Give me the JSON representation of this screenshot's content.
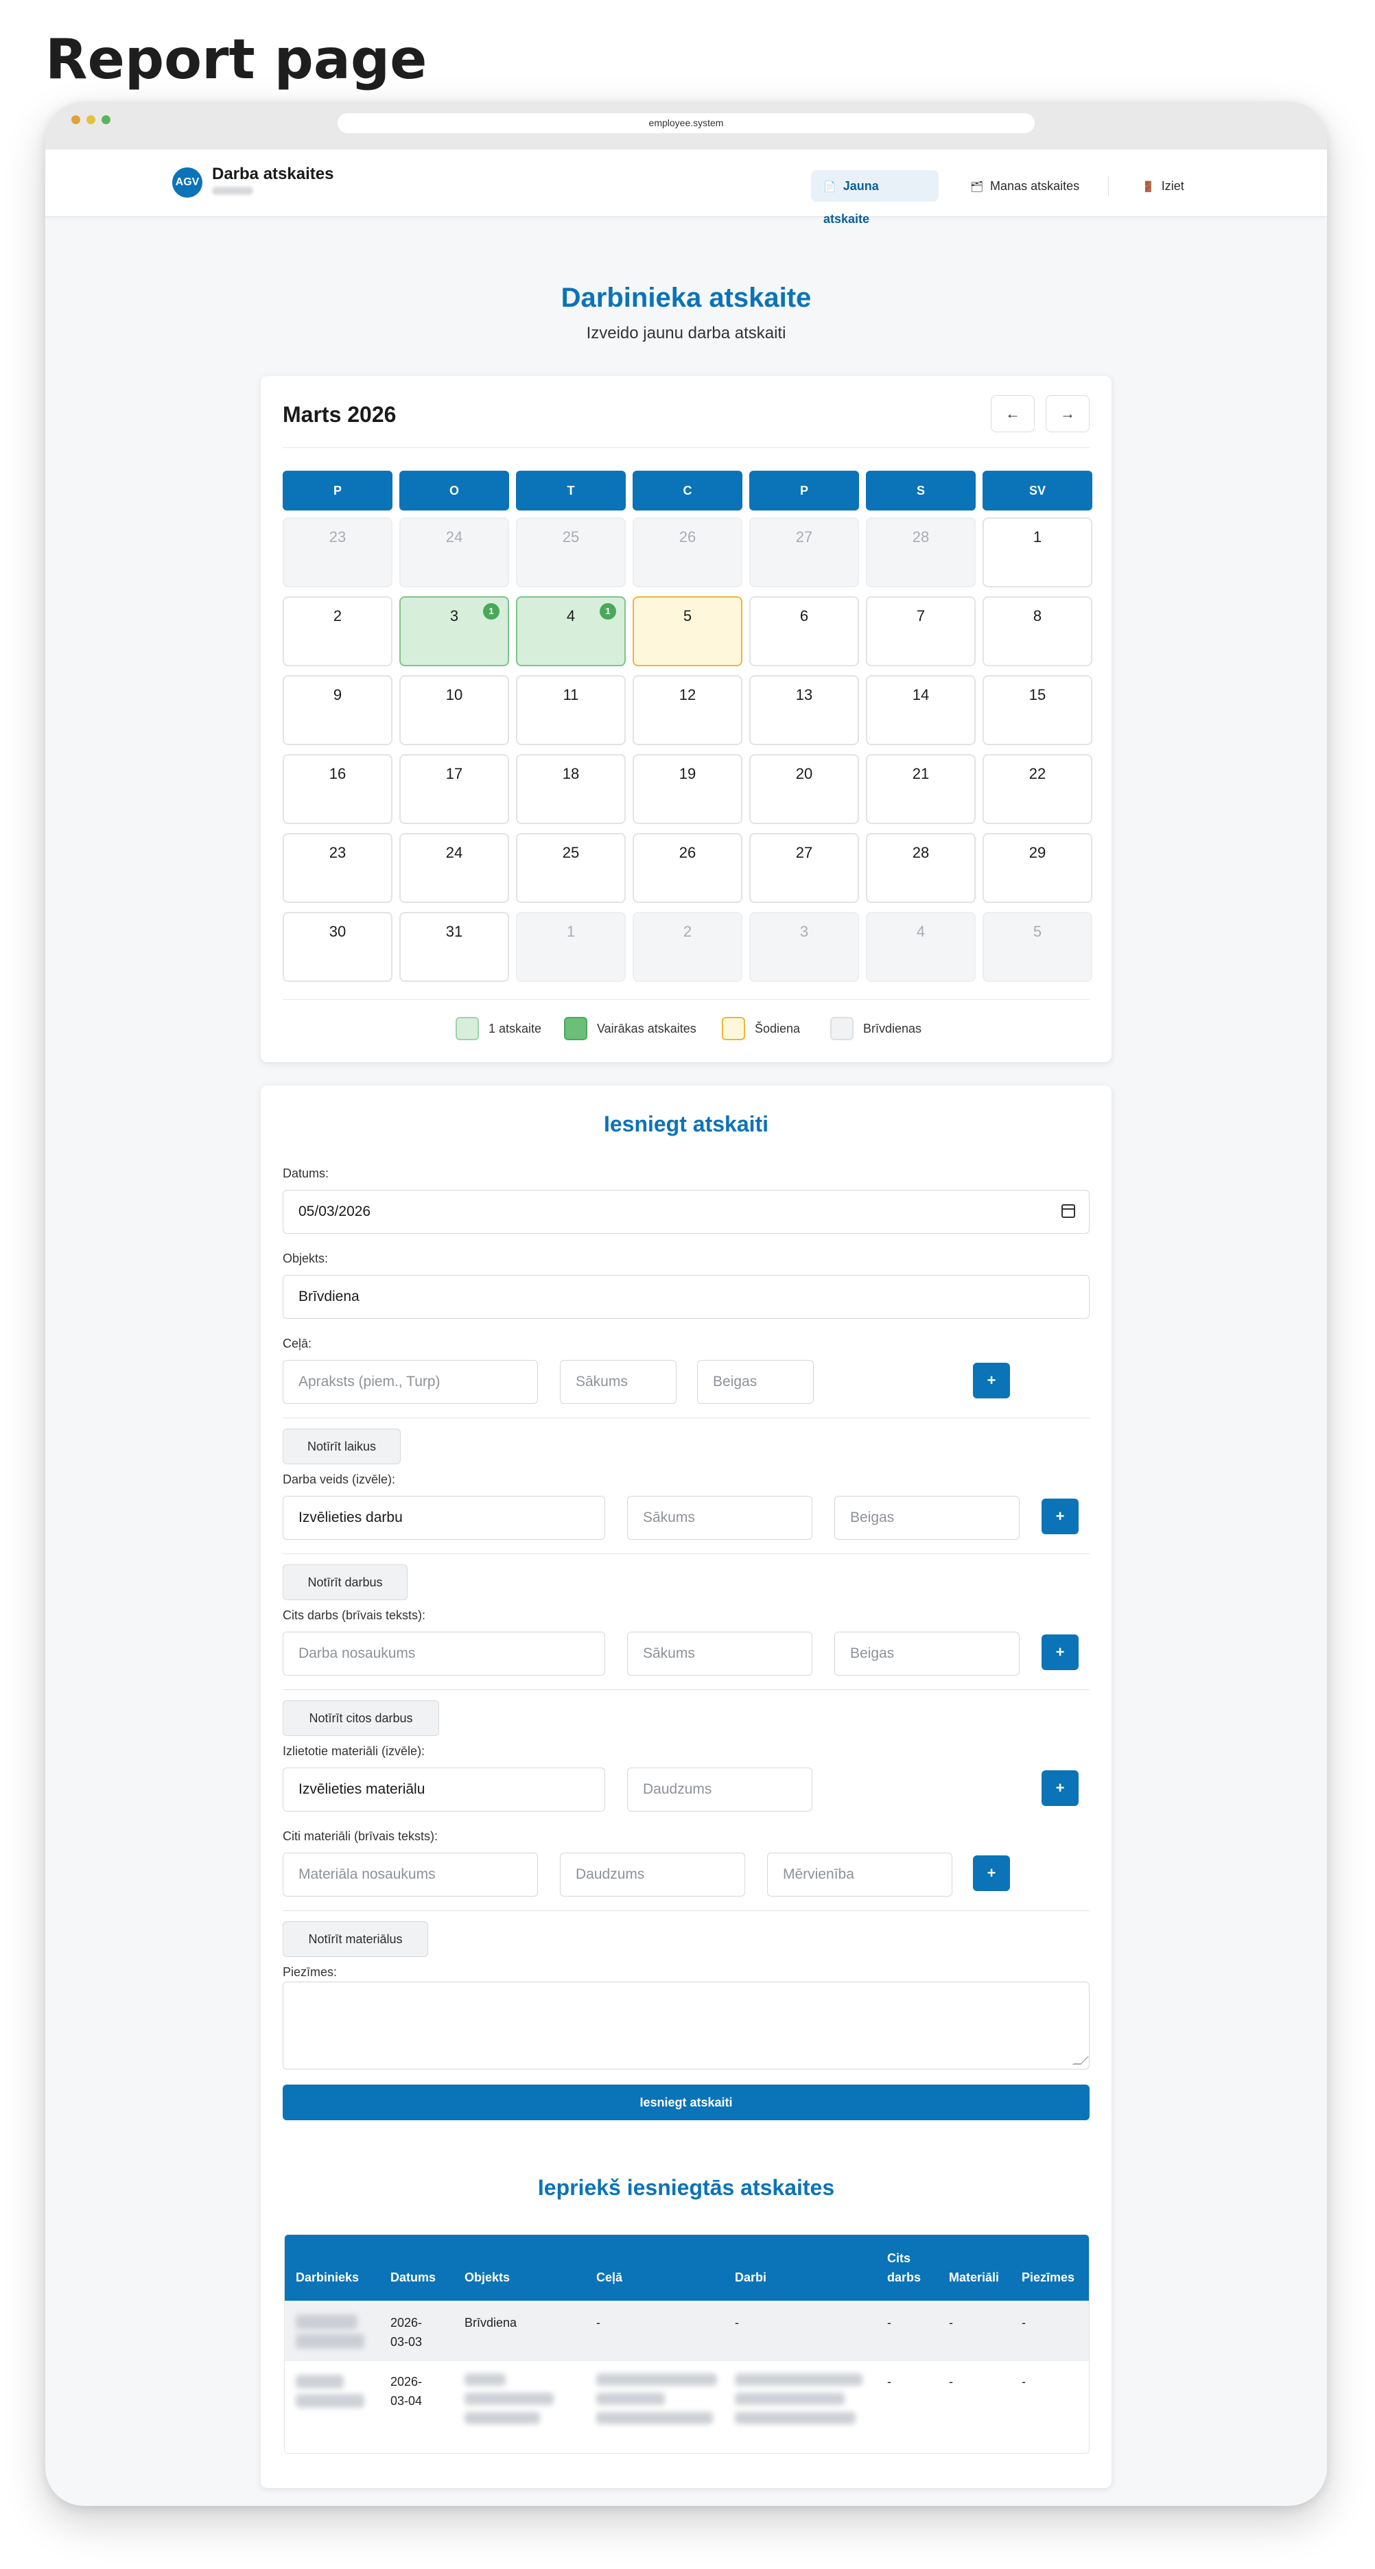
{
  "screenshot_title": "Report page",
  "browser": {
    "url": "employee.system"
  },
  "header": {
    "logo_text": "AGV",
    "app_name": "Darba atskaites",
    "nav": [
      {
        "icon": "document-icon",
        "glyph": "📄",
        "label": "Jauna atskaite",
        "active": true
      },
      {
        "icon": "folder-icon",
        "glyph": "🗂",
        "label": "Manas atskaites",
        "active": false
      },
      {
        "icon": "door-icon",
        "glyph": "🚪",
        "label": "Iziet",
        "active": false
      }
    ]
  },
  "main": {
    "title": "Darbinieka atskaite",
    "subtitle": "Izveido jaunu darba atskaiti"
  },
  "calendar": {
    "month_label": "Marts 2026",
    "prev_glyph": "←",
    "next_glyph": "→",
    "weekdays": [
      "P",
      "O",
      "T",
      "C",
      "P",
      "S",
      "SV"
    ],
    "weeks": [
      [
        {
          "d": "23",
          "other": true
        },
        {
          "d": "24",
          "other": true
        },
        {
          "d": "25",
          "other": true
        },
        {
          "d": "26",
          "other": true
        },
        {
          "d": "27",
          "other": true
        },
        {
          "d": "28",
          "other": true
        },
        {
          "d": "1"
        }
      ],
      [
        {
          "d": "2"
        },
        {
          "d": "3",
          "reports": "1"
        },
        {
          "d": "4",
          "reports": "1"
        },
        {
          "d": "5",
          "today": true
        },
        {
          "d": "6"
        },
        {
          "d": "7"
        },
        {
          "d": "8"
        }
      ],
      [
        {
          "d": "9"
        },
        {
          "d": "10"
        },
        {
          "d": "11"
        },
        {
          "d": "12"
        },
        {
          "d": "13"
        },
        {
          "d": "14"
        },
        {
          "d": "15"
        }
      ],
      [
        {
          "d": "16"
        },
        {
          "d": "17"
        },
        {
          "d": "18"
        },
        {
          "d": "19"
        },
        {
          "d": "20"
        },
        {
          "d": "21"
        },
        {
          "d": "22"
        }
      ],
      [
        {
          "d": "23"
        },
        {
          "d": "24"
        },
        {
          "d": "25"
        },
        {
          "d": "26"
        },
        {
          "d": "27"
        },
        {
          "d": "28"
        },
        {
          "d": "29"
        }
      ],
      [
        {
          "d": "30"
        },
        {
          "d": "31"
        },
        {
          "d": "1",
          "other": true
        },
        {
          "d": "2",
          "other": true
        },
        {
          "d": "3",
          "other": true
        },
        {
          "d": "4",
          "other": true
        },
        {
          "d": "5",
          "other": true
        }
      ]
    ],
    "legend": [
      {
        "label": "1 atskaite",
        "color": "#d7eedb",
        "border": "#9fd3aa"
      },
      {
        "label": "Vairākas atskaites",
        "color": "#6bbf78",
        "border": "#4aa85a"
      },
      {
        "label": "Šodiena",
        "color": "#fff7dc",
        "border": "#f0b534"
      },
      {
        "label": "Brīvdienas",
        "color": "#f1f2f4",
        "border": "#dcdfe3"
      }
    ]
  },
  "form": {
    "title": "Iesniegt atskaiti",
    "date": {
      "label": "Datums:",
      "value": "05/03/2026"
    },
    "object": {
      "label": "Objekts:",
      "value": "Brīvdiena"
    },
    "travel": {
      "label": "Ceļā:",
      "desc_placeholder": "Apraksts (piem., Turp)",
      "start_placeholder": "Sākums",
      "end_placeholder": "Beigas",
      "add": "+",
      "clear": "Notīrīt laikus"
    },
    "work_type": {
      "label": "Darba veids (izvēle):",
      "value": "Izvēlieties darbu",
      "start_placeholder": "Sākums",
      "end_placeholder": "Beigas",
      "add": "+",
      "clear": "Notīrīt darbus"
    },
    "other_work": {
      "label": "Cits darbs (brīvais teksts):",
      "name_placeholder": "Darba nosaukums",
      "start_placeholder": "Sākums",
      "end_placeholder": "Beigas",
      "add": "+",
      "clear": "Notīrīt citos darbus"
    },
    "materials": {
      "label": "Izlietotie materiāli (izvēle):",
      "value": "Izvēlieties materiālu",
      "qty_placeholder": "Daudzums",
      "add": "+"
    },
    "other_materials": {
      "label": "Citi materiāli (brīvais teksts):",
      "name_placeholder": "Materiāla nosaukums",
      "qty_placeholder": "Daudzums",
      "unit_placeholder": "Mērvienība",
      "add": "+",
      "clear": "Notīrīt materiālus"
    },
    "notes": {
      "label": "Piezīmes:"
    },
    "submit": "Iesniegt atskaiti"
  },
  "previous": {
    "title": "Iepriekš iesniegtās atskaites",
    "columns": [
      "Darbinieks",
      "Datums",
      "Objekts",
      "Ceļā",
      "Darbi",
      "Cits darbs",
      "Materiāli",
      "Piezīmes"
    ],
    "rows": [
      {
        "date": "2026-03-03",
        "object": "Brīvdiena",
        "travel": "-",
        "work": "-",
        "other": "-",
        "materials": "-",
        "notes": "-"
      },
      {
        "date": "2026-03-04",
        "object": "",
        "travel": "",
        "work": "",
        "other": "-",
        "materials": "-",
        "notes": "-"
      }
    ]
  }
}
